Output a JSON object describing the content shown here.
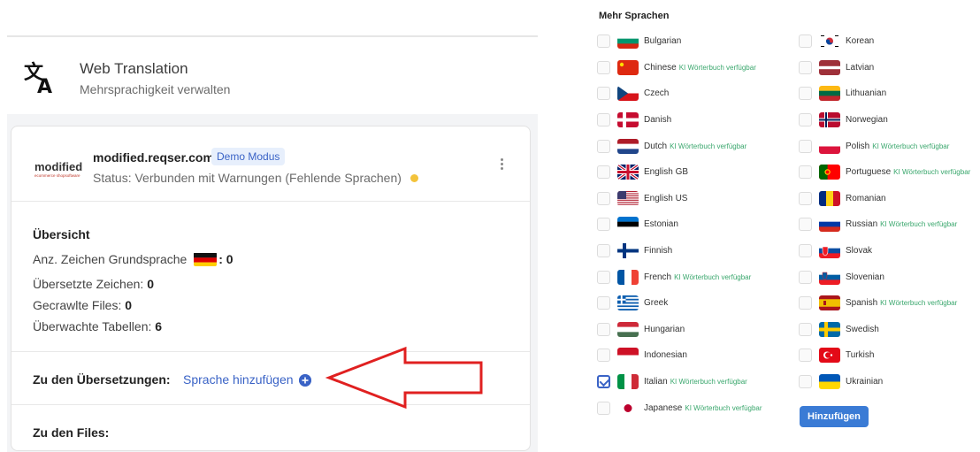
{
  "app": {
    "title": "Web Translation",
    "subtitle": "Mehrsprachigkeit verwalten"
  },
  "site": {
    "brand": "modified",
    "brand_tagline": "ecommerce shopsoftware",
    "domain": "modified.reqser.com",
    "badge": "Demo Modus",
    "status": "Status: Verbunden mit Warnungen (Fehlende Sprachen)"
  },
  "overview": {
    "title": "Übersicht",
    "chars_base_label": "Anz. Zeichen Grundsprache",
    "chars_base_value": ": 0",
    "translated_label": "Übersetzte Zeichen:",
    "translated_value": "0",
    "crawled_label": "Gecrawlte Files:",
    "crawled_value": "0",
    "tables_label": "Überwachte Tabellen:",
    "tables_value": "6"
  },
  "translations": {
    "label": "Zu den Übersetzungen:",
    "add_link": "Sprache hinzufügen"
  },
  "files": {
    "label": "Zu den Files:"
  },
  "languages_panel": {
    "title": "Mehr Sprachen",
    "ki_note": "KI Wörterbuch verfügbar",
    "button": "Hinzufügen",
    "col1": [
      {
        "name": "Bulgarian",
        "ki": false,
        "checked": false,
        "flag": "bg"
      },
      {
        "name": "Chinese",
        "ki": true,
        "checked": false,
        "flag": "cn"
      },
      {
        "name": "Czech",
        "ki": false,
        "checked": false,
        "flag": "cz"
      },
      {
        "name": "Danish",
        "ki": false,
        "checked": false,
        "flag": "dk"
      },
      {
        "name": "Dutch",
        "ki": true,
        "checked": false,
        "flag": "nl"
      },
      {
        "name": "English GB",
        "ki": false,
        "checked": false,
        "flag": "gb"
      },
      {
        "name": "English US",
        "ki": false,
        "checked": false,
        "flag": "us"
      },
      {
        "name": "Estonian",
        "ki": false,
        "checked": false,
        "flag": "ee"
      },
      {
        "name": "Finnish",
        "ki": false,
        "checked": false,
        "flag": "fi"
      },
      {
        "name": "French",
        "ki": true,
        "checked": false,
        "flag": "fr"
      },
      {
        "name": "Greek",
        "ki": false,
        "checked": false,
        "flag": "gr"
      },
      {
        "name": "Hungarian",
        "ki": false,
        "checked": false,
        "flag": "hu"
      },
      {
        "name": "Indonesian",
        "ki": false,
        "checked": false,
        "flag": "id"
      },
      {
        "name": "Italian",
        "ki": true,
        "checked": true,
        "flag": "it"
      },
      {
        "name": "Japanese",
        "ki": true,
        "checked": false,
        "flag": "jp"
      }
    ],
    "col2": [
      {
        "name": "Korean",
        "ki": false,
        "checked": false,
        "flag": "kr"
      },
      {
        "name": "Latvian",
        "ki": false,
        "checked": false,
        "flag": "lv"
      },
      {
        "name": "Lithuanian",
        "ki": false,
        "checked": false,
        "flag": "lt"
      },
      {
        "name": "Norwegian",
        "ki": false,
        "checked": false,
        "flag": "no"
      },
      {
        "name": "Polish",
        "ki": true,
        "checked": false,
        "flag": "pl"
      },
      {
        "name": "Portuguese",
        "ki": true,
        "checked": false,
        "flag": "pt"
      },
      {
        "name": "Romanian",
        "ki": false,
        "checked": false,
        "flag": "ro"
      },
      {
        "name": "Russian",
        "ki": true,
        "checked": false,
        "flag": "ru"
      },
      {
        "name": "Slovak",
        "ki": false,
        "checked": false,
        "flag": "sk"
      },
      {
        "name": "Slovenian",
        "ki": false,
        "checked": false,
        "flag": "si"
      },
      {
        "name": "Spanish",
        "ki": true,
        "checked": false,
        "flag": "es"
      },
      {
        "name": "Swedish",
        "ki": false,
        "checked": false,
        "flag": "se"
      },
      {
        "name": "Turkish",
        "ki": false,
        "checked": false,
        "flag": "tr"
      },
      {
        "name": "Ukrainian",
        "ki": false,
        "checked": false,
        "flag": "ua"
      }
    ]
  },
  "colors": {
    "accent": "#3a63c6",
    "button": "#3a7bd5",
    "ki_green": "#3aa76d",
    "warning_dot": "#f3c33b",
    "arrow_red": "#e02020"
  }
}
